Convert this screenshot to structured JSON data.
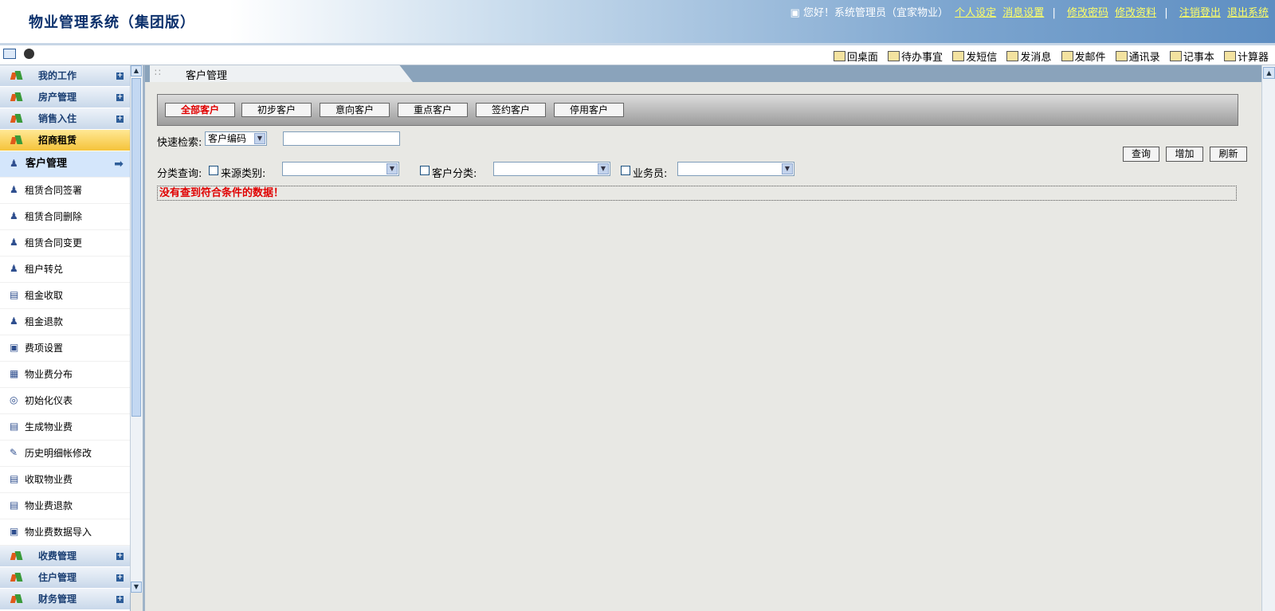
{
  "header": {
    "title": "物业管理系统（集团版）",
    "greeting": "您好！系统管理员（宜家物业）",
    "links": [
      "个人设定",
      "消息设置",
      "修改密码",
      "修改资料",
      "注销登出",
      "退出系统"
    ]
  },
  "toolbar": {
    "items": [
      "回桌面",
      "待办事宜",
      "发短信",
      "发消息",
      "发邮件",
      "通讯录",
      "记事本",
      "计算器"
    ]
  },
  "sidebar": {
    "groups_top": [
      "我的工作",
      "房产管理",
      "销售入住"
    ],
    "active_group": "招商租赁",
    "items": [
      "客户管理",
      "租赁合同签署",
      "租赁合同删除",
      "租赁合同变更",
      "租户转兑",
      "租金收取",
      "租金退款",
      "费项设置",
      "物业费分布",
      "初始化仪表",
      "生成物业费",
      "历史明细帐修改",
      "收取物业费",
      "物业费退款",
      "物业费数据导入"
    ],
    "groups_bottom": [
      "收费管理",
      "住户管理",
      "财务管理"
    ]
  },
  "tab": {
    "label": "客户管理"
  },
  "filters": [
    "全部客户",
    "初步客户",
    "意向客户",
    "重点客户",
    "签约客户",
    "停用客户"
  ],
  "search": {
    "quick_label": "快速检索:",
    "quick_field": "客户编码",
    "quick_value": "",
    "category_label": "分类查询:",
    "source_label": "来源类别:",
    "customer_class_label": "客户分类:",
    "salesman_label": "业务员:"
  },
  "actions": {
    "query": "查询",
    "add": "增加",
    "refresh": "刷新"
  },
  "message": "没有查到符合条件的数据！",
  "colors": {
    "active_red": "#e00000",
    "header_blue": "#0a2f6b",
    "link_yellow": "#ffff66"
  }
}
